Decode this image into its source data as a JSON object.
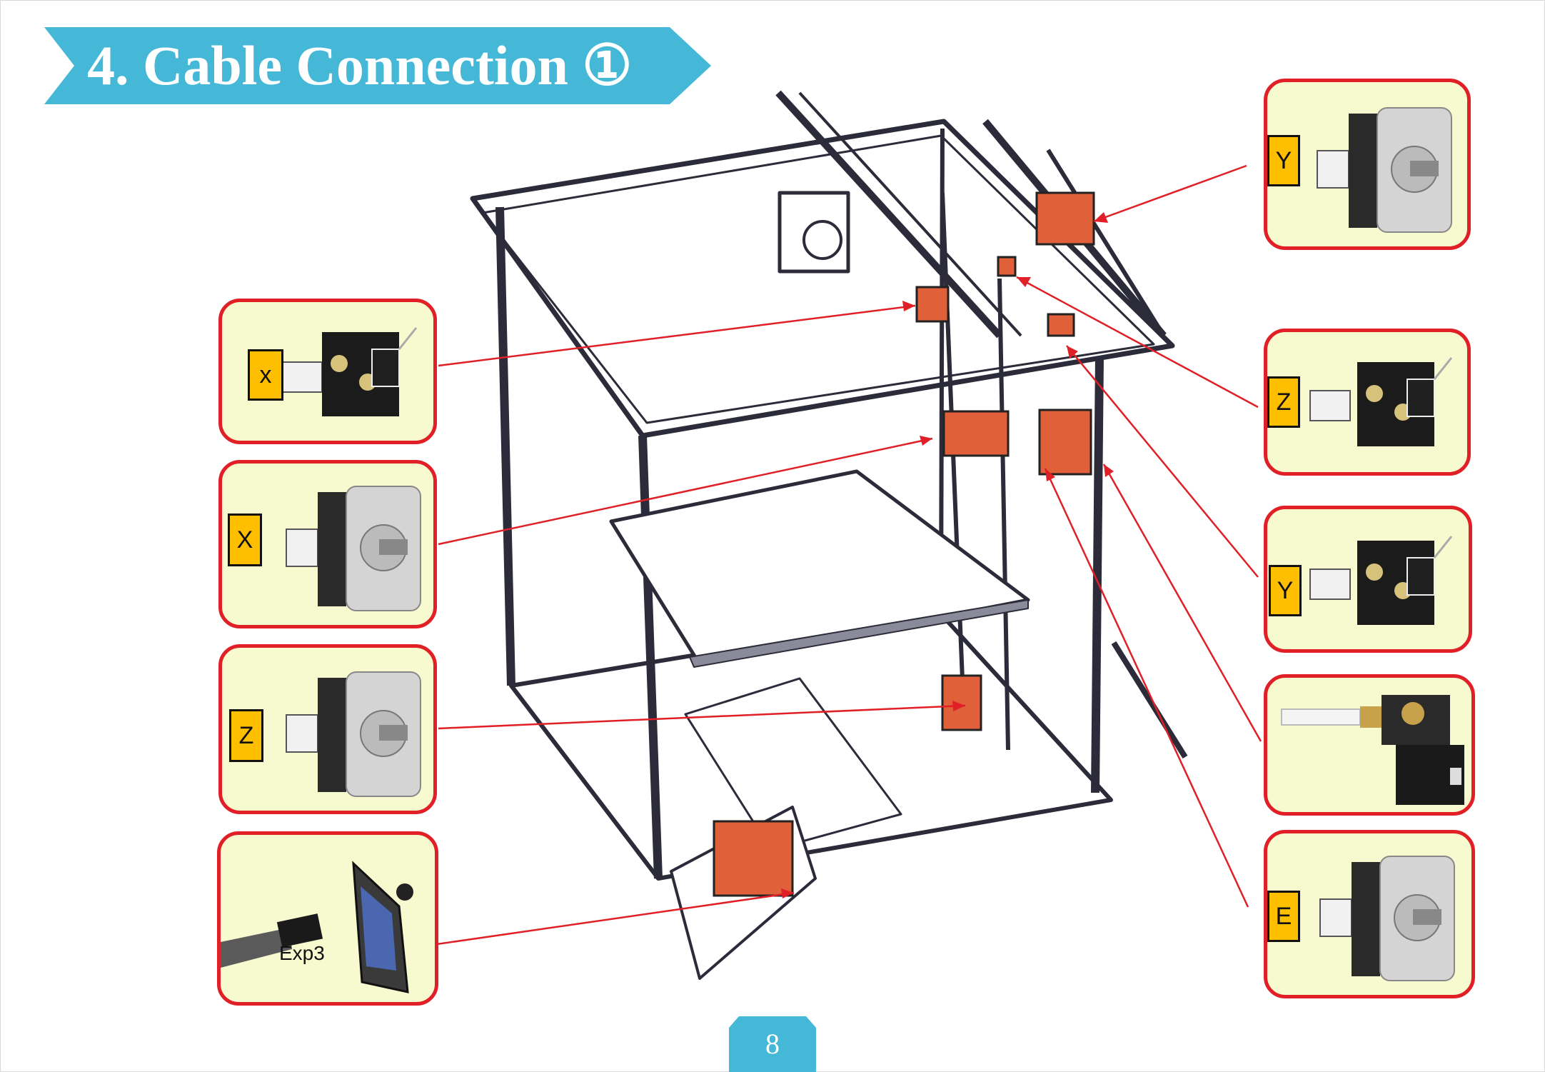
{
  "title": "4. Cable Connection ①",
  "page_number": "8",
  "colors": {
    "banner": "#45b8d8",
    "callout_border": "#e01f26",
    "callout_fill": "#f7f9cf",
    "label_fill": "#fdbf00",
    "arrow": "#e01f26",
    "highlight_part": "#e0603a"
  },
  "callouts": {
    "x_endstop": {
      "label": "x",
      "part": "endstop-switch"
    },
    "x_motor": {
      "label": "X",
      "part": "stepper-motor"
    },
    "z_motor": {
      "label": "Z",
      "part": "stepper-motor"
    },
    "display": {
      "label": "Exp3",
      "part": "lcd-display"
    },
    "y_motor": {
      "label": "Y",
      "part": "stepper-motor"
    },
    "z_endstop": {
      "label": "Z",
      "part": "endstop-switch"
    },
    "y_endstop": {
      "label": "Y",
      "part": "endstop-switch"
    },
    "extruder": {
      "label": "",
      "part": "extruder-assembly"
    },
    "e_motor": {
      "label": "E",
      "part": "stepper-motor"
    }
  }
}
